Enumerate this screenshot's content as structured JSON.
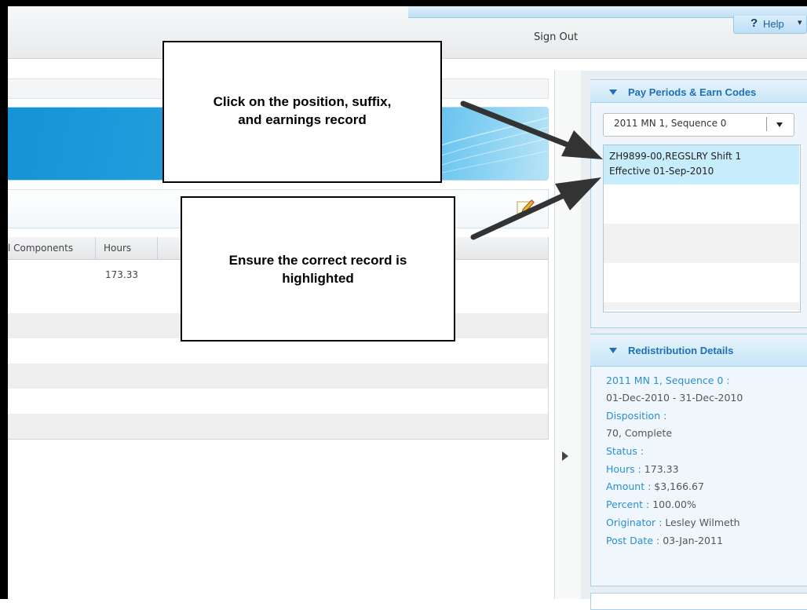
{
  "header": {
    "help_label": "Help",
    "help_glyph": "?",
    "sign_out_label": "Sign Out"
  },
  "grid": {
    "columns": [
      "l Components",
      "Hours"
    ],
    "rows": [
      {
        "hours": "173.33"
      }
    ]
  },
  "pay_periods_panel": {
    "title": "Pay Periods & Earn Codes",
    "selected_period": "2011 MN 1, Sequence 0",
    "records": [
      {
        "line1": "ZH9899-00,REGSLRY Shift 1",
        "line2": "Effective 01-Sep-2010",
        "selected": true
      }
    ]
  },
  "redistribution_panel": {
    "title": "Redistribution Details",
    "period_label": "2011 MN 1, Sequence 0 :",
    "period_range": "01-Dec-2010 - 31-Dec-2010",
    "disposition_label": "Disposition :",
    "disposition_value": "70, Complete",
    "status_label": "Status :",
    "hours_label": "Hours :",
    "hours_value": "173.33",
    "amount_label": "Amount :",
    "amount_value": "$3,166.67",
    "percent_label": "Percent :",
    "percent_value": "100.00%",
    "originator_label": "Originator :",
    "originator_value": "Lesley Wilmeth",
    "post_date_label": "Post Date :",
    "post_date_value": "03-Jan-2011"
  },
  "callouts": {
    "first_line1": "Click on the position, suffix,",
    "first_line2": "and earnings record",
    "second_line1": "Ensure the correct record is",
    "second_line2": "highlighted"
  },
  "colors": {
    "accent": "#1f6fb8",
    "banner": "#1593d6",
    "selected_row": "#c7ecfb"
  }
}
